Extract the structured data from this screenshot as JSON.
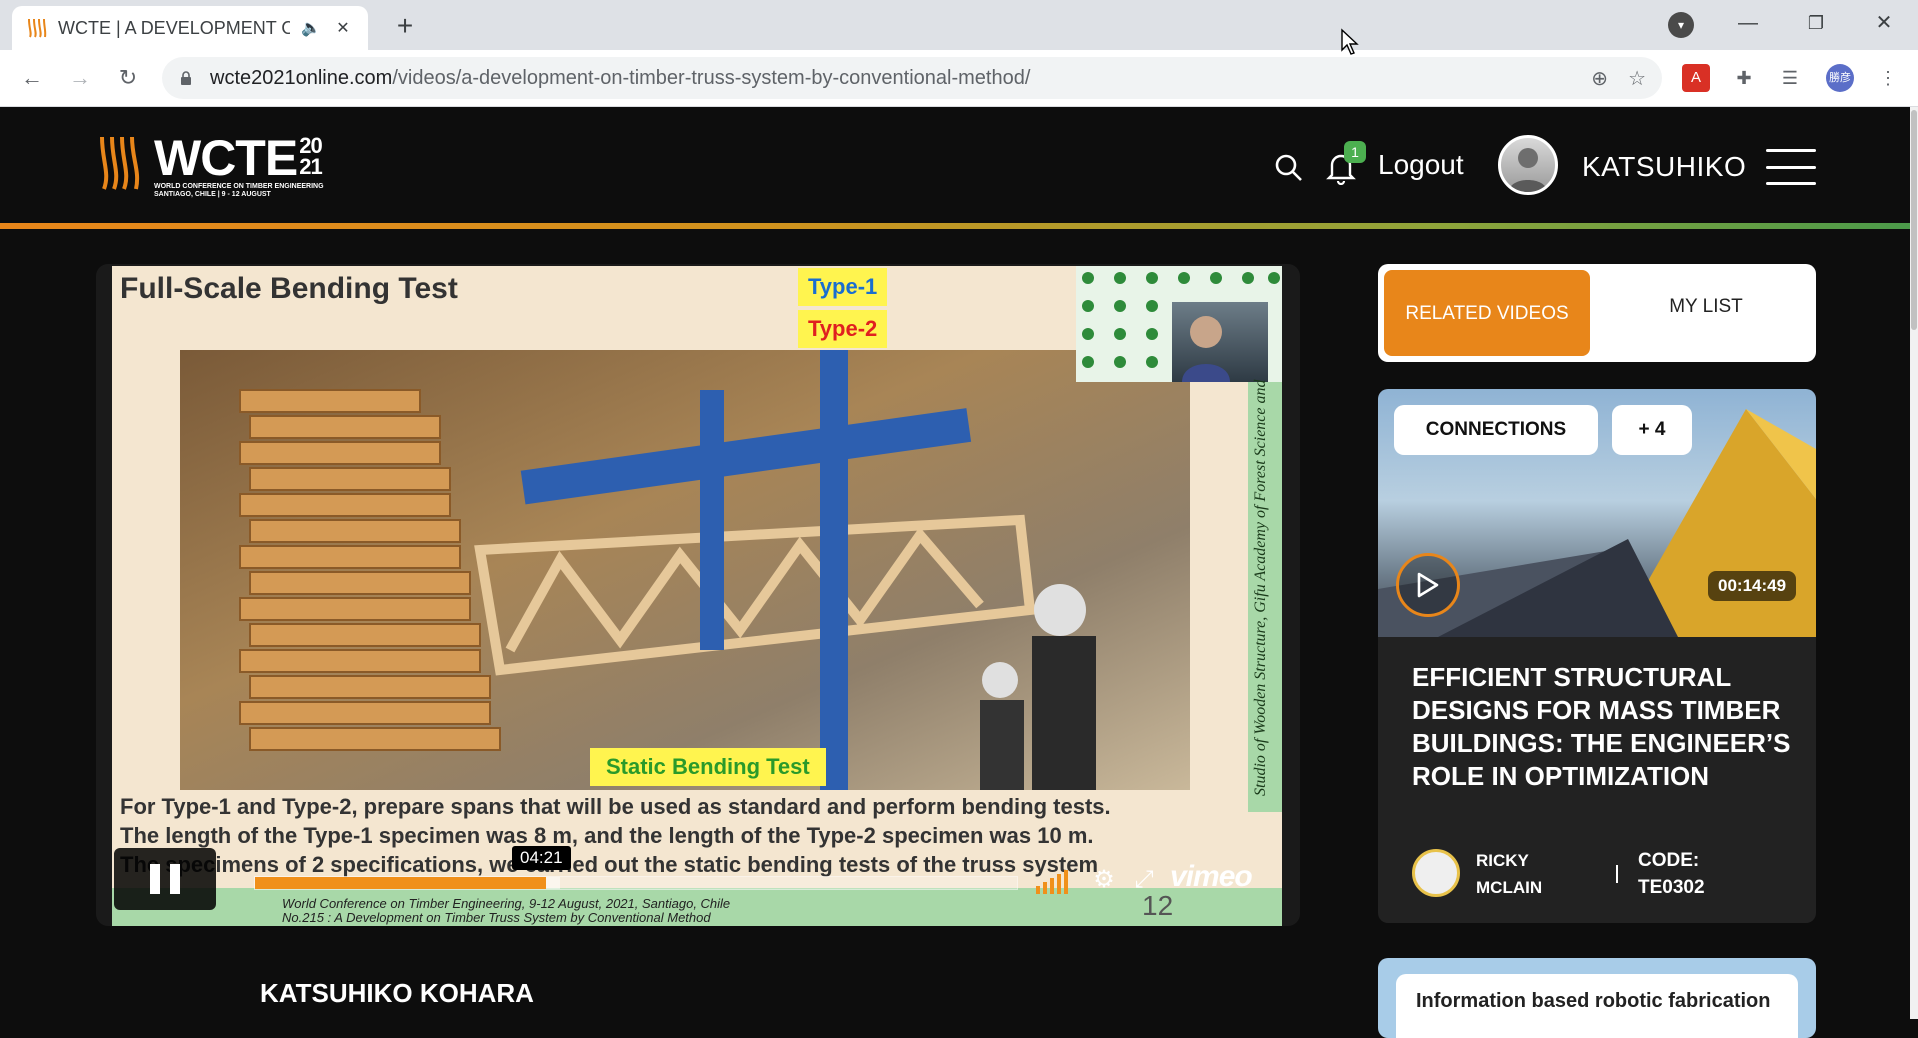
{
  "browser": {
    "tab_title": "WCTE | A DEVELOPMENT ON",
    "url_host": "wcte2021online.com",
    "url_path": "/videos/a-development-on-timber-truss-system-by-conventional-method/",
    "profile_initials": "勝彦"
  },
  "header": {
    "logo_main": "WCTE",
    "logo_year_top": "20",
    "logo_year_bottom": "21",
    "logo_sub_1": "WORLD CONFERENCE ON TIMBER ENGINEERING",
    "logo_sub_2": "SANTIAGO, CHILE | 9 - 12 AUGUST",
    "notification_count": "1",
    "logout_label": "Logout",
    "user_name": "KATSUHIKO"
  },
  "video": {
    "slide_title": "Full-Scale Bending Test",
    "type1_label": "Type-1",
    "type2_label": "Type-2",
    "static_label": "Static Bending Test",
    "side_caption": "Studio of Wooden Structure, Gifu Academy of Forest Science and",
    "body_line_1": "For Type-1 and Type-2, prepare spans that will be used as standard and perform bending tests.",
    "body_line_2": "The length of the Type-1 specimen was 8 m, and the length of the Type-2 specimen was 10 m.",
    "body_line_3": "The specimens of 2 specifications, we carried out the static bending tests of the truss system",
    "footer_line_1": "World Conference on Timber Engineering, 9-12 August, 2021, Santiago, Chile",
    "footer_line_2": "No.215 : A Development on Timber Truss System by Conventional Method",
    "page_number": "12",
    "time_tooltip": "04:21",
    "progress_fraction": 0.382,
    "hover_fraction": 0.4,
    "player_brand": "vimeo"
  },
  "speaker": {
    "name": "KATSUHIKO KOHARA"
  },
  "sidebar": {
    "tab_related": "RELATED VIDEOS",
    "tab_mylist": "MY LIST",
    "card": {
      "chip_1": "CONNECTIONS",
      "chip_2": "+ 4",
      "duration": "00:14:49",
      "title": "EFFICIENT STRUCTURAL DESIGNS FOR MASS TIMBER BUILDINGS: THE ENGINEER’S ROLE IN OPTIMIZATION",
      "author_first": "RICKY",
      "author_last": "MCLAIN",
      "code_label": "CODE:",
      "code_value": "TE0302"
    },
    "card2_title": "Information based robotic fabrication"
  },
  "colors": {
    "accent": "#e8861a",
    "badge": "#4caf50",
    "slide_green": "#a8d8a8"
  }
}
